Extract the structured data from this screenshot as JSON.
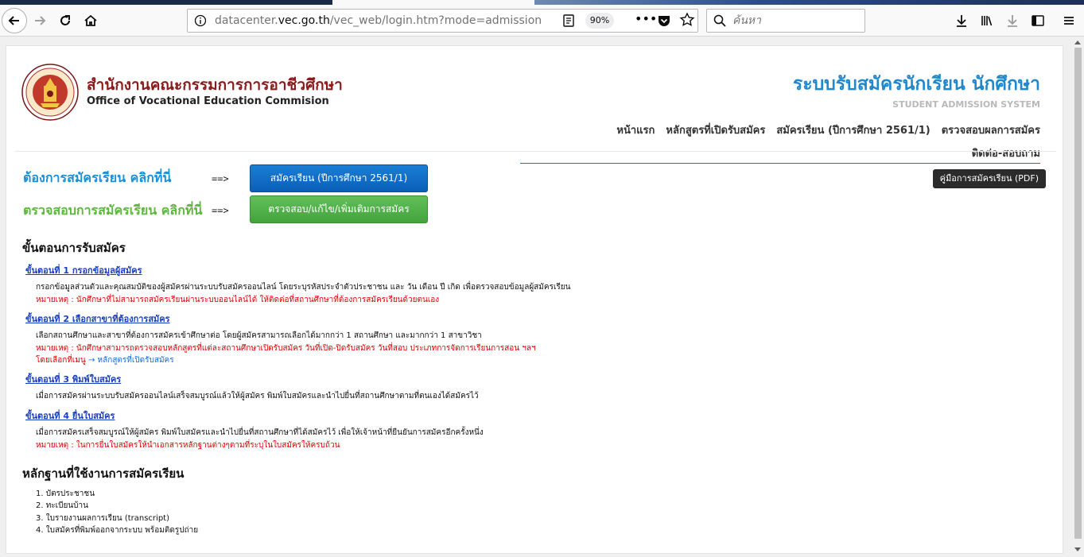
{
  "browser": {
    "url_prefix": "datacenter.",
    "url_domain": "vec.go.th",
    "url_path": "/vec_web/login.htm?mode=admission",
    "zoom": "90%",
    "page_actions_label": "•••",
    "search_placeholder": "ค้นหา"
  },
  "header": {
    "org_name_th": "สำนักงานคณะกรรมการการอาชีวศึกษา",
    "org_name_en": "Office of Vocational Education Commision",
    "system_title": "ระบบรับสมัครนักเรียน นักศึกษา",
    "system_subtitle": "STUDENT ADMISSION SYSTEM"
  },
  "nav": {
    "items": [
      "หน้าแรก",
      "หลักสูตรที่เปิดรับสมัคร",
      "สมัครเรียน (ปีการศึกษา 2561/1)",
      "ตรวจสอบผลการสมัคร",
      "ติดต่อ-สอบถาม"
    ]
  },
  "cta": {
    "apply_label": "ต้องการสมัครเรียน คลิกที่นี่",
    "apply_arrow": "==>",
    "apply_button": "สมัครเรียน (ปีการศึกษา 2561/1)",
    "check_label": "ตรวจสอบการสมัครเรียน คลิกที่นี่",
    "check_arrow": "==>",
    "check_button": "ตรวจสอบ/แก้ไข/เพิ่มเติมการสมัคร",
    "manual_button": "คู่มือการสมัครเรียน (PDF)"
  },
  "steps": {
    "heading": "ขั้นตอนการรับสมัคร",
    "items": [
      {
        "title": "ขั้นตอนที่ 1 กรอกข้อมูลผู้สมัคร",
        "desc": "กรอกข้อมูลส่วนตัวและคุณสมบัติของผู้สมัครผ่านระบบรับสมัครออนไลน์ โดยระบุรหัสประจำตัวประชาชน และ วัน เดือน ปี เกิด เพื่อตรวจสอบข้อมูลผู้สมัครเรียน",
        "note": "หมายเหตุ : นักศึกษาที่ไม่สามารถสมัครเรียนผ่านระบบออนไลน์ได้ ให้ติดต่อที่สถานศึกษาที่ต้องการสมัครเรียนด้วยตนเอง"
      },
      {
        "title": "ขั้นตอนที่ 2 เลือกสาขาที่ต้องการสมัคร",
        "desc": "เลือกสถานศึกษาและสาขาที่ต้องการสมัครเข้าศึกษาต่อ โดยผู้สมัครสามารถเลือกได้มากกว่า 1 สถานศึกษา และมากกว่า 1 สาขาวิชา",
        "note": "หมายเหตุ : นักศึกษาสามารถตรวจสอบหลักสูตรที่แต่ละสถานศึกษาเปิดรับสมัคร วันที่เปิด-ปิดรับสมัคร วันที่สอบ ประเภทการจัดการเรียนการสอน ฯลฯ",
        "note2_prefix": "โดยเลือกที่เมนู",
        "note2_arrow": "→",
        "note2_link": "หลักสูตรที่เปิดรับสมัคร"
      },
      {
        "title": "ขั้นตอนที่ 3 พิมพ์ใบสมัคร",
        "desc": "เมื่อการสมัครผ่านระบบรับสมัครออนไลน์เสร็จสมบูรณ์แล้วให้ผู้สมัคร พิมพ์ใบสมัครและนำไปยื่นที่สถานศึกษาตามที่ตนเองได้สมัครไว้"
      },
      {
        "title": "ขั้นตอนที่ 4 ยื่นใบสมัคร",
        "desc": "เมื่อการสมัครเสร็จสมบูรณ์ให้ผู้สมัคร พิมพ์ใบสมัครและนำไปยื่นที่สถานศึกษาที่ได้สมัครไว้ เพื่อให้เจ้าหน้าที่ยืนยันการสมัครอีกครั้งหนึ่ง",
        "note": "หมายเหตุ : ในการยื่นใบสมัครให้นำเอกสารหลักฐานต่างๆตามที่ระบุในใบสมัครให้ครบถ้วน"
      }
    ]
  },
  "documents": {
    "heading": "หลักฐานที่ใช้งานการสมัครเรียน",
    "items": [
      "1. บัตรประชาชน",
      "2. ทะเบียนบ้าน",
      "3. ใบรายงานผลการเรียน (transcript)",
      "4. ใบสมัครที่พิมพ์ออกจากระบบ พร้อมติดรูปถ่าย"
    ]
  },
  "colors": {
    "org_red": "#8b1a1a",
    "title_blue": "#2288cc",
    "apply_blue": "#0b5fb8",
    "check_green": "#43a33d",
    "note_red": "#e00000",
    "link_blue": "#1a3ec0"
  }
}
